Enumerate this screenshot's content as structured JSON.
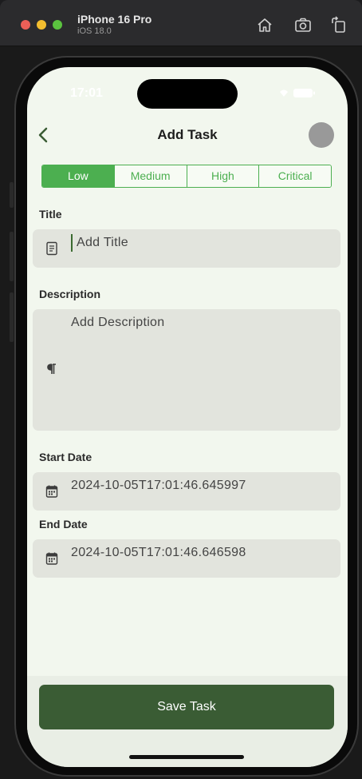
{
  "simulator": {
    "device_name": "iPhone 16 Pro",
    "os_version": "iOS 18.0",
    "toolbar_icons": [
      "home-icon",
      "screenshot-icon",
      "rotate-icon"
    ]
  },
  "status_bar": {
    "time": "17:01"
  },
  "header": {
    "title": "Add Task",
    "back_icon": "chevron-left-icon"
  },
  "priority": {
    "options": [
      "Low",
      "Medium",
      "High",
      "Critical"
    ],
    "selected": "Low"
  },
  "form": {
    "title_label": "Title",
    "title_placeholder": "Add Title",
    "title_icon": "document-icon",
    "description_label": "Description",
    "description_placeholder": "Add Description",
    "description_icon": "paragraph-icon",
    "start_date_label": "Start Date",
    "start_date_value": "2024-10-05T17:01:46.645997",
    "end_date_label": "End Date",
    "end_date_value": "2024-10-05T17:01:46.646598",
    "date_icon": "calendar-icon"
  },
  "footer": {
    "save_label": "Save Task"
  },
  "colors": {
    "accent_green": "#4caf50",
    "button_dark_green": "#3a5c34",
    "background": "#f2f7ee",
    "field_bg": "#e2e4dd"
  }
}
